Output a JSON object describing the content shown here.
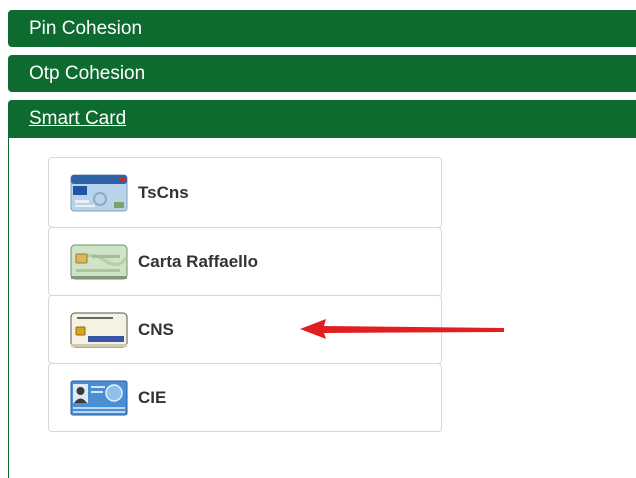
{
  "accordion": {
    "sections": [
      {
        "title": "Pin Cohesion"
      },
      {
        "title": "Otp Cohesion"
      },
      {
        "title": "Smart Card"
      }
    ]
  },
  "smart_card": {
    "options": [
      {
        "label": "TsCns",
        "icon": "tscns-card-icon"
      },
      {
        "label": "Carta Raffaello",
        "icon": "carta-raffaello-card-icon"
      },
      {
        "label": "CNS",
        "icon": "cns-card-icon"
      },
      {
        "label": "CIE",
        "icon": "cie-card-icon"
      }
    ]
  },
  "colors": {
    "header_bg": "#0d6b2f",
    "annotation_arrow": "#e02020"
  }
}
